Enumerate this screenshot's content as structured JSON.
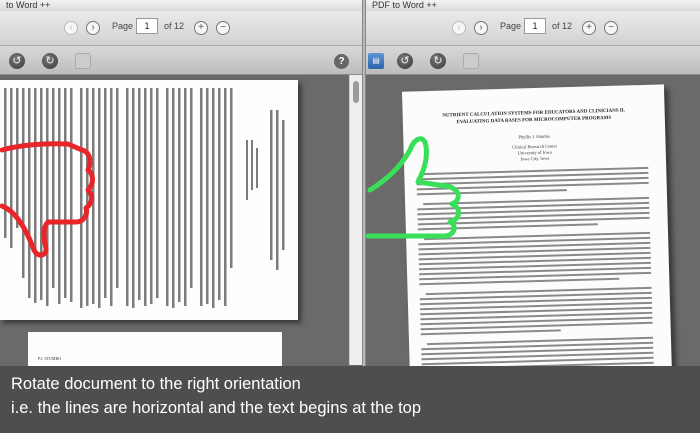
{
  "left_window": {
    "title": "to Word",
    "title_suffix": "++",
    "page_label": "Page",
    "page_value": "1",
    "page_total": "of 12",
    "help_label": "?",
    "bottom_page_heading": "P.J. STUMBO"
  },
  "right_window": {
    "title": "PDF to Word",
    "title_suffix": "++",
    "page_label": "Page",
    "page_value": "1",
    "page_total": "of 12"
  },
  "icons": {
    "prev": "‹",
    "next": "›",
    "zoom_in": "+",
    "zoom_out": "−",
    "rotate_left": "↺",
    "rotate_right": "↻"
  },
  "document": {
    "heading": "NUTRIENT CALCULATION SYSTEMS FOR EDUCATORS AND CLINICIANS II. EVALUATING DATA BASES FOR MICROCOMPUTER PROGRAMS",
    "author": "Phyllis J. Stumbo",
    "affiliation_1": "Clinical Research Center",
    "affiliation_2": "University of Iowa",
    "affiliation_3": "Iowa City, Iowa"
  },
  "caption": {
    "line1": "Rotate document to the right orientation",
    "line2": "i.e. the lines are horizontal and the text begins at the top"
  },
  "colors": {
    "thumbs_down": "#e8262a",
    "thumbs_up": "#38e05a"
  }
}
